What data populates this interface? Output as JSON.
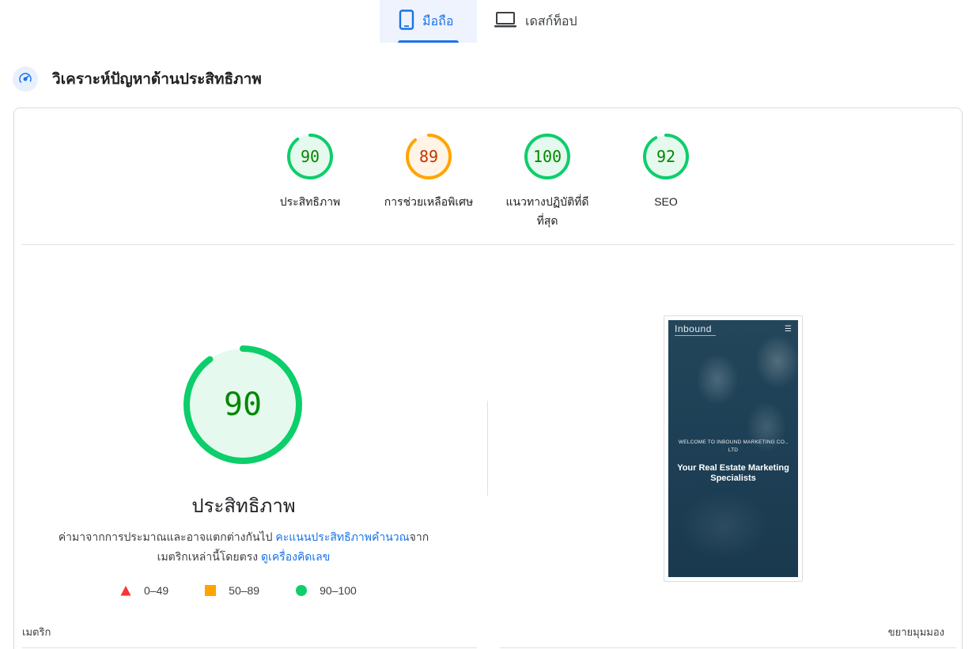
{
  "tabs": [
    {
      "label": "มือถือ",
      "icon": "smartphone-icon",
      "active": true
    },
    {
      "label": "เดสก์ท็อป",
      "icon": "laptop-icon",
      "active": false
    }
  ],
  "section": {
    "title": "วิเคราะห์ปัญหาด้านประสิทธิภาพ",
    "icon": "gauge-icon"
  },
  "scores": [
    {
      "value": "90",
      "label": "ประสิทธิภาพ",
      "status": "pass"
    },
    {
      "value": "89",
      "label": "การช่วยเหลือพิเศษ",
      "status": "average"
    },
    {
      "value": "100",
      "label": "แนวทางปฏิบัติที่ดีที่สุด",
      "status": "pass"
    },
    {
      "value": "92",
      "label": "SEO",
      "status": "pass"
    }
  ],
  "colors": {
    "pass": "#0cce6b",
    "pass_text": "#008800",
    "pass_bg": "#e6f9ee",
    "average": "#ffa400",
    "average_text": "#c33300",
    "average_bg": "#fff4e5",
    "fail": "#ff3333",
    "accent": "#1a73e8"
  },
  "main": {
    "score": "90",
    "title": "ประสิทธิภาพ",
    "desc_prefix": "ค่ามาจากการประมาณและอาจแตกต่างกันไป ",
    "desc_link1": "คะแนนประสิทธิภาพคำนวณ",
    "desc_middle": "จากเมตริกเหล่านี้โดยตรง ",
    "desc_link2": "ดูเครื่องคิดเลข"
  },
  "legend": [
    {
      "range": "0–49",
      "shape": "triangle"
    },
    {
      "range": "50–89",
      "shape": "square"
    },
    {
      "range": "90–100",
      "shape": "circle"
    }
  ],
  "screenshot": {
    "brand": "Inbound",
    "welcome": "WELCOME TO INBOUND MARKETING CO., LTD",
    "headline": "Your Real Estate Marketing Specialists"
  },
  "footer": {
    "metrics_label": "เมตริก",
    "expand_label": "ขยายมุมมอง"
  }
}
